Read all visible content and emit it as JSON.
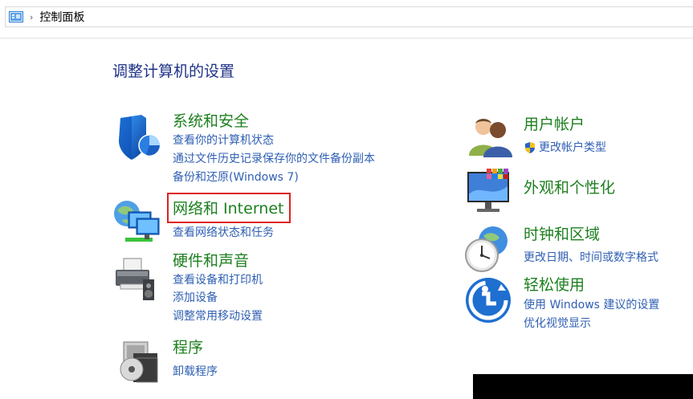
{
  "breadcrumb": {
    "separator": "›",
    "location": "控制面板"
  },
  "page_title": "调整计算机的设置",
  "left_categories": [
    {
      "title": "系统和安全",
      "links": [
        "查看你的计算机状态",
        "通过文件历史记录保存你的文件备份副本",
        "备份和还原(Windows 7)"
      ]
    },
    {
      "title": "网络和 Internet",
      "links": [
        "查看网络状态和任务"
      ]
    },
    {
      "title": "硬件和声音",
      "links": [
        "查看设备和打印机",
        "添加设备",
        "调整常用移动设置"
      ]
    },
    {
      "title": "程序",
      "links": [
        "卸载程序"
      ]
    }
  ],
  "right_categories": [
    {
      "title": "用户帐户",
      "links": [
        "更改帐户类型"
      ]
    },
    {
      "title": "外观和个性化",
      "links": []
    },
    {
      "title": "时钟和区域",
      "links": [
        "更改日期、时间或数字格式"
      ]
    },
    {
      "title": "轻松使用",
      "links": [
        "使用 Windows 建议的设置",
        "优化视觉显示"
      ]
    }
  ],
  "colors": {
    "title_blue": "#1e3287",
    "category_green": "#1e8020",
    "link_blue": "#2f5fb3",
    "highlight_red": "#e02020"
  },
  "icons": {
    "address": "control-panel-icon",
    "system_security": "shield-icon",
    "network": "network-globe-icon",
    "hardware": "printer-icon",
    "programs": "programs-disc-icon",
    "user_accounts": "users-icon",
    "uac": "uac-shield-icon",
    "appearance": "monitor-palette-icon",
    "clock": "clock-globe-icon",
    "ease_of_access": "ease-of-access-icon"
  }
}
